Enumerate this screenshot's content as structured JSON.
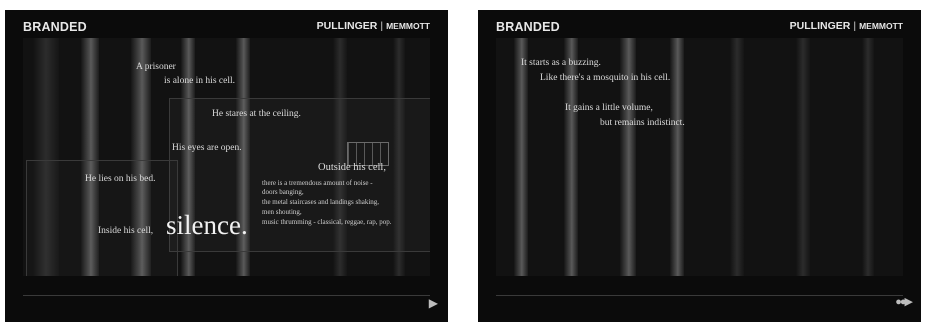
{
  "left": {
    "brand": "BRANDED",
    "authors": {
      "a1": "PULLINGER",
      "sep": "|",
      "a2": "MEMMOTT"
    },
    "lines": {
      "l1": "A prisoner",
      "l2": "is alone in his cell.",
      "l3": "He stares at the ceiling.",
      "l4": "His eyes are open.",
      "l5": "Outside his cell,",
      "l6": "He lies on his bed.",
      "small1": "there is a tremendous amount of noise -",
      "small2": "doors banging,",
      "small3": "the metal staircases and landings shaking,",
      "small4": "men shouting,",
      "small5": "music thrumming - classical, reggae, rap, pop.",
      "l7": "Inside his cell,",
      "l8": "silence."
    },
    "nav": {
      "next_icon": "▶"
    }
  },
  "right": {
    "brand": "BRANDED",
    "authors": {
      "a1": "PULLINGER",
      "sep": "|",
      "a2": "MEMMOTT"
    },
    "lines": {
      "r1": "It starts as a buzzing.",
      "r2": "Like there's a mosquito in his cell.",
      "r3": "It gains a little volume,",
      "r4": "but remains indistinct."
    },
    "nav": {
      "dots_icon": "●●▶"
    }
  }
}
